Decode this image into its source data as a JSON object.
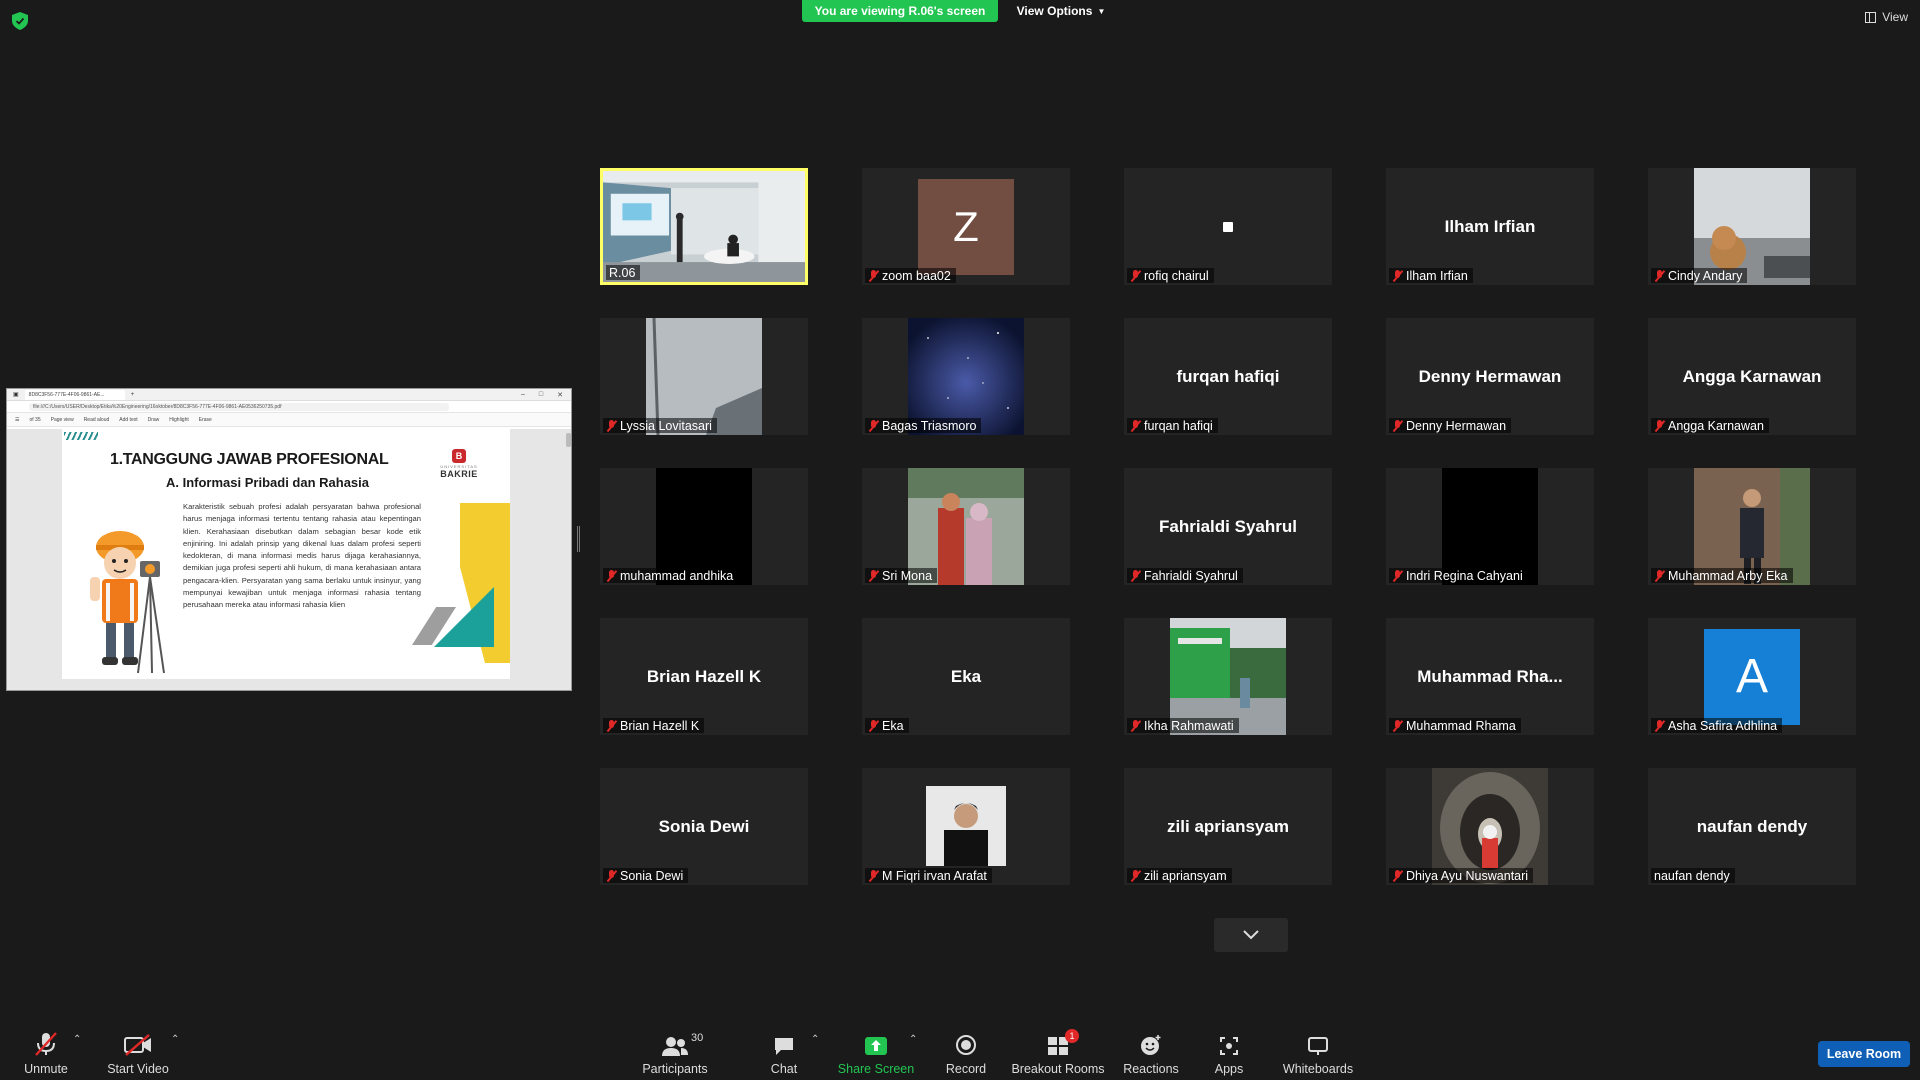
{
  "top": {
    "viewing_banner": "You are viewing R.06's screen",
    "view_options": "View Options",
    "view_button": "View"
  },
  "shared_screen": {
    "browser_tab": "8D8C3F56-777E-4F06-9861-AE...",
    "url": "file:///C:/Users/USER/Desktop/Etika%20Engineering/16oktober/8D8C3F56-777E-4F06-9861-AE0536250735.pdf",
    "page_indicator": "of 35",
    "pdf_tools": [
      "Page view",
      "Read aloud",
      "Add text",
      "Draw",
      "Highlight",
      "Erase"
    ],
    "slide": {
      "heading": "1.TANGGUNG JAWAB PROFESIONAL",
      "subheading": "A. Informasi Pribadi dan Rahasia",
      "logo_univ": "UNIVERSITAS",
      "logo_name": "BAKRIE",
      "body": "Karakteristik sebuah profesi adalah persyaratan bahwa profesional harus menjaga informasi tertentu tentang rahasia atau kepentingan klien. Kerahasiaan disebutkan dalam sebagian besar kode etik enjiniring. Ini adalah prinsip yang dikenal luas dalam profesi seperti kedokteran, di mana informasi medis harus dijaga kerahasiannya, demikian juga profesi seperti ahli hukum, di mana kerahasiaan antara pengacara-klien. Persyaratan yang sama berlaku untuk insinyur, yang mempunyai kewajiban untuk menjaga informasi rahasia tentang perusahaan mereka atau informasi rahasia klien"
    }
  },
  "gallery": [
    {
      "label": "R.06",
      "display": "",
      "type": "video-room",
      "muted": false
    },
    {
      "label": "zoom baa02",
      "display": "Z",
      "type": "avatar-letter",
      "muted": true
    },
    {
      "label": "rofiq chairul",
      "display": "",
      "type": "dot",
      "muted": true
    },
    {
      "label": "Ilham Irfian",
      "display": "Ilham Irfian",
      "type": "name",
      "muted": true
    },
    {
      "label": "Cindy Andary",
      "display": "",
      "type": "photo-dog",
      "muted": true
    },
    {
      "label": "Lyssia Lovitasari",
      "display": "",
      "type": "photo-sky",
      "muted": true
    },
    {
      "label": "Bagas Triasmoro",
      "display": "",
      "type": "photo-stars",
      "muted": true
    },
    {
      "label": "furqan hafiqi",
      "display": "furqan hafiqi",
      "type": "name",
      "muted": true
    },
    {
      "label": "Denny Hermawan",
      "display": "Denny Hermawan",
      "type": "name",
      "muted": true
    },
    {
      "label": "Angga Karnawan",
      "display": "Angga Karnawan",
      "type": "name",
      "muted": true
    },
    {
      "label": "muhammad andhika",
      "display": "",
      "type": "black",
      "muted": true
    },
    {
      "label": "Sri Mona",
      "display": "",
      "type": "photo-couple",
      "muted": true
    },
    {
      "label": "Fahrialdi Syahrul",
      "display": "Fahrialdi Syahrul",
      "type": "name",
      "muted": true
    },
    {
      "label": "Indri Regina Cahyani",
      "display": "",
      "type": "black",
      "muted": true
    },
    {
      "label": "Muhammad Arby Eka",
      "display": "",
      "type": "photo-man",
      "muted": true
    },
    {
      "label": "Brian Hazell K",
      "display": "Brian Hazell K",
      "type": "name",
      "muted": true
    },
    {
      "label": "Eka",
      "display": "Eka",
      "type": "name",
      "muted": true
    },
    {
      "label": "Ikha Rahmawati",
      "display": "",
      "type": "photo-building",
      "muted": true
    },
    {
      "label": "Muhammad Rhama",
      "display": "Muhammad  Rha...",
      "type": "name",
      "muted": true
    },
    {
      "label": "Asha Safira Adhlina",
      "display": "A",
      "type": "avatar-blue",
      "muted": true
    },
    {
      "label": "Sonia Dewi",
      "display": "Sonia Dewi",
      "type": "name",
      "muted": true
    },
    {
      "label": "M Fiqri irvan Arafat",
      "display": "",
      "type": "photo-portrait",
      "muted": true
    },
    {
      "label": "zili apriansyam",
      "display": "zili apriansyam",
      "type": "name",
      "muted": true
    },
    {
      "label": "Dhiya Ayu Nuswantari",
      "display": "",
      "type": "photo-tunnel",
      "muted": true
    },
    {
      "label": "naufan dendy",
      "display": "naufan dendy",
      "type": "name",
      "muted": false
    }
  ],
  "toolbar": {
    "unmute": "Unmute",
    "start_video": "Start Video",
    "participants": "Participants",
    "participants_count": "30",
    "chat": "Chat",
    "share_screen": "Share Screen",
    "record": "Record",
    "breakout_rooms": "Breakout Rooms",
    "breakout_badge": "1",
    "reactions": "Reactions",
    "apps": "Apps",
    "whiteboards": "Whiteboards",
    "leave_room": "Leave Room"
  },
  "colors": {
    "banner_green": "#23c552",
    "share_green": "#23c552",
    "active_border": "#ffff66",
    "muted_red": "#e02828",
    "leave_blue": "#0e5fb5"
  }
}
